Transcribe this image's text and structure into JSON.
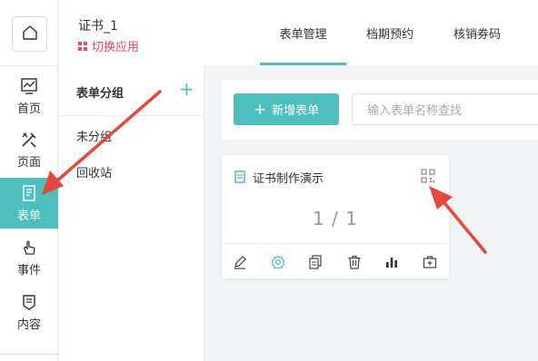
{
  "app": {
    "title": "证书_1",
    "switch_label": "切换应用"
  },
  "nav": {
    "items": [
      {
        "label": "首页",
        "icon": "chart-icon"
      },
      {
        "label": "页面",
        "icon": "tools-icon"
      },
      {
        "label": "表单",
        "icon": "form-icon",
        "active": true
      },
      {
        "label": "事件",
        "icon": "touch-icon"
      },
      {
        "label": "内容",
        "icon": "content-icon"
      }
    ]
  },
  "tabs": [
    {
      "label": "表单管理",
      "active": true
    },
    {
      "label": "档期预约"
    },
    {
      "label": "核销券码"
    }
  ],
  "groups": {
    "title": "表单分组",
    "add_symbol": "+",
    "items": [
      "未分组",
      "回收站"
    ]
  },
  "toolbar": {
    "new_form_label": "新增表单",
    "search_placeholder": "输入表单名称查找"
  },
  "form_card": {
    "name": "证书制作演示",
    "count": "1 / 1",
    "actions": [
      "edit-icon",
      "settings-icon",
      "copy-icon",
      "delete-icon",
      "stats-icon",
      "export-icon"
    ]
  },
  "colors": {
    "accent": "#4dbfbf",
    "switch": "#f5455b",
    "annotation": "#e8473c"
  }
}
